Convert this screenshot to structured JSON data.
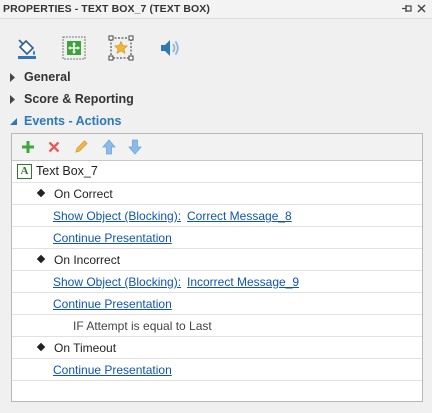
{
  "title": "PROPERTIES - TEXT BOX_7 (TEXT BOX)",
  "title_buttons": {
    "pin": "ᅳ",
    "close": "✕"
  },
  "tools": [
    {
      "name": "fill-bucket-icon"
    },
    {
      "name": "position-size-icon"
    },
    {
      "name": "star-box-icon",
      "selected": true
    },
    {
      "name": "audio-icon"
    }
  ],
  "sections": [
    {
      "label": "General",
      "open": false
    },
    {
      "label": "Score & Reporting",
      "open": false
    },
    {
      "label": "Events - Actions",
      "open": true
    }
  ],
  "colors": {
    "accent": "#2e78b8",
    "link": "#1155b0",
    "add": "#39a939",
    "delete": "#e06060",
    "edit": "#f0b84a",
    "move": "#6aa6e0"
  },
  "events": {
    "object": "Text Box_7",
    "groups": [
      {
        "trigger": "On Correct",
        "actions": [
          {
            "action": "Show Object (Blocking):",
            "target": "Correct Message_8"
          },
          {
            "action": "Continue Presentation",
            "target": ""
          }
        ]
      },
      {
        "trigger": "On Incorrect",
        "actions": [
          {
            "action": "Show Object (Blocking):",
            "target": "Incorrect Message_9"
          },
          {
            "action": "Continue Presentation",
            "target": ""
          }
        ],
        "condition": "IF Attempt is equal to Last"
      },
      {
        "trigger": "On Timeout",
        "actions": [
          {
            "action": "Continue Presentation",
            "target": ""
          }
        ]
      }
    ]
  }
}
